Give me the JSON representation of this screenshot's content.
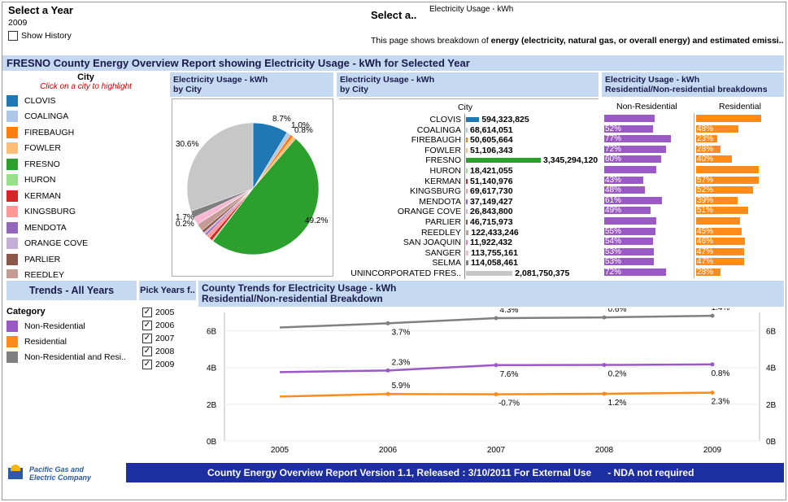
{
  "header": {
    "select_year_label": "Select a Year",
    "year_value": "2009",
    "show_history_label": "Show History",
    "select_energy_label": "Select a..",
    "energy_value": "Electricity Usage - kWh",
    "description_prefix": "This page shows breakdown of ",
    "description_bold": "energy (electricity, natural gas, or overall energy) and estimated emissi.."
  },
  "title_bar": "FRESNO County Energy Overview Report showing Electricity Usage - kWh for Selected Year",
  "legend": {
    "title": "City",
    "subtitle": "Click on a city to highlight",
    "items": [
      {
        "label": "CLOVIS",
        "color": "#1f77b4"
      },
      {
        "label": "COALINGA",
        "color": "#aec7e8"
      },
      {
        "label": "FIREBAUGH",
        "color": "#ff7f0e"
      },
      {
        "label": "FOWLER",
        "color": "#ffbb78"
      },
      {
        "label": "FRESNO",
        "color": "#2ca02c"
      },
      {
        "label": "HURON",
        "color": "#98df8a"
      },
      {
        "label": "KERMAN",
        "color": "#d62728"
      },
      {
        "label": "KINGSBURG",
        "color": "#ff9896"
      },
      {
        "label": "MENDOTA",
        "color": "#9467bd"
      },
      {
        "label": "ORANGE COVE",
        "color": "#c5b0d5"
      },
      {
        "label": "PARLIER",
        "color": "#8c564b"
      },
      {
        "label": "REEDLEY",
        "color": "#c49c94"
      }
    ]
  },
  "pie_panel": {
    "title_line1": "Electricity Usage - kWh",
    "title_line2": "by City",
    "labels": [
      "8.7%",
      "1.0%",
      "0.8%",
      "30.6%",
      "49.2%",
      "1.7%",
      "0.2%"
    ]
  },
  "bar_panel": {
    "title_line1": "Electricity Usage - kWh",
    "title_line2": "by City",
    "column_header": "City"
  },
  "split_panel": {
    "title_line1": "Electricity Usage - kWh",
    "title_line2": "Residential/Non-residential breakdowns",
    "col_nonres": "Non-Residential",
    "col_res": "Residential",
    "nonres_color": "#9b59c6",
    "res_color": "#ff8c1a"
  },
  "trends": {
    "heading": "Trends - All Years",
    "category_label": "Category",
    "categories": [
      {
        "label": "Non-Residential",
        "color": "#9b59c6"
      },
      {
        "label": "Residential",
        "color": "#ff8c1a"
      },
      {
        "label": "Non-Residential and Resi..",
        "color": "#808080"
      }
    ],
    "pick_years_label": "Pick Years f..",
    "years": [
      "2005",
      "2006",
      "2007",
      "2008",
      "2009"
    ],
    "chart_title_line1": "County Trends for Electricity Usage - kWh",
    "chart_title_line2": "Residential/Non-residential Breakdown",
    "y_ticks": [
      "6B",
      "4B",
      "2B",
      "0B"
    ]
  },
  "footer": {
    "logo_line1": "Pacific Gas and",
    "logo_line2": "Electric Company",
    "banner": "County Energy Overview Report Version 1.1, Released : 3/10/2011  For External Use",
    "nda": "- NDA not required"
  },
  "chart_data": [
    {
      "type": "pie",
      "title": "Electricity Usage - kWh by City",
      "slices": [
        {
          "label": "CLOVIS",
          "value": 8.7
        },
        {
          "label": "COALINGA",
          "value": 1.0
        },
        {
          "label": "FIREBAUGH",
          "value": 0.8
        },
        {
          "label": "FOWLER",
          "value": 0.8
        },
        {
          "label": "FRESNO",
          "value": 49.2
        },
        {
          "label": "HURON",
          "value": 0.3
        },
        {
          "label": "KERMAN",
          "value": 0.8
        },
        {
          "label": "KINGSBURG",
          "value": 1.0
        },
        {
          "label": "MENDOTA",
          "value": 0.5
        },
        {
          "label": "ORANGE COVE",
          "value": 0.4
        },
        {
          "label": "PARLIER",
          "value": 0.7
        },
        {
          "label": "REEDLEY",
          "value": 1.8
        },
        {
          "label": "SAN JOAQUIN",
          "value": 0.2
        },
        {
          "label": "SANGER",
          "value": 1.7
        },
        {
          "label": "SELMA",
          "value": 1.7
        },
        {
          "label": "UNINCORPORATED FRES..",
          "value": 30.6
        }
      ]
    },
    {
      "type": "bar",
      "title": "Electricity Usage - kWh by City",
      "categories": [
        "CLOVIS",
        "COALINGA",
        "FIREBAUGH",
        "FOWLER",
        "FRESNO",
        "HURON",
        "KERMAN",
        "KINGSBURG",
        "MENDOTA",
        "ORANGE COVE",
        "PARLIER",
        "REEDLEY",
        "SAN JOAQUIN",
        "SANGER",
        "SELMA",
        "UNINCORPORATED FRES.."
      ],
      "values": [
        594323825,
        68614051,
        50605664,
        51106343,
        3345294120,
        18421055,
        51140976,
        69617730,
        37149427,
        26843800,
        46715973,
        122433246,
        11922432,
        113755161,
        114058461,
        2081750375
      ],
      "value_labels": [
        "594,323,825",
        "68,614,051",
        "50,605,664",
        "51,106,343",
        "3,345,294,120",
        "18,421,055",
        "51,140,976",
        "69,617,730",
        "37,149,427",
        "26,843,800",
        "46,715,973",
        "122,433,246",
        "11,922,432",
        "113,755,161",
        "114,058,461",
        "2,081,750,375"
      ],
      "colors": [
        "#1f77b4",
        "#aec7e8",
        "#ff7f0e",
        "#ffbb78",
        "#2ca02c",
        "#98df8a",
        "#d62728",
        "#ff9896",
        "#9467bd",
        "#c5b0d5",
        "#8c564b",
        "#c49c94",
        "#e377c2",
        "#f7b6d2",
        "#7f7f7f",
        "#c7c7c7"
      ]
    },
    {
      "type": "bar",
      "title": "Residential/Non-residential breakdowns",
      "categories": [
        "CLOVIS",
        "COALINGA",
        "FIREBAUGH",
        "FOWLER",
        "FRESNO",
        "HURON",
        "KERMAN",
        "KINGSBURG",
        "MENDOTA",
        "ORANGE COVE",
        "PARLIER",
        "REEDLEY",
        "SAN JOAQUIN",
        "SANGER",
        "SELMA",
        "UNINCORPORATED FRES.."
      ],
      "series": [
        {
          "name": "Non-Residential",
          "values": [
            null,
            52,
            77,
            72,
            60,
            null,
            43,
            48,
            61,
            49,
            null,
            55,
            54,
            53,
            53,
            72
          ],
          "labels": [
            "",
            "52%",
            "77%",
            "72%",
            "60%",
            "",
            "43%",
            "48%",
            "61%",
            "49%",
            "",
            "55%",
            "54%",
            "53%",
            "53%",
            "72%"
          ],
          "bar_frac": [
            0.62,
            0.6,
            0.82,
            0.76,
            0.7,
            0.64,
            0.48,
            0.5,
            0.71,
            0.57,
            0.64,
            0.63,
            0.6,
            0.61,
            0.61,
            0.76
          ]
        },
        {
          "name": "Residential",
          "values": [
            null,
            48,
            23,
            28,
            40,
            null,
            57,
            52,
            39,
            51,
            null,
            45,
            46,
            47,
            47,
            28
          ],
          "labels": [
            "",
            "48%",
            "23%",
            "28%",
            "40%",
            "",
            "57%",
            "52%",
            "39%",
            "51%",
            "",
            "45%",
            "46%",
            "47%",
            "47%",
            "28%"
          ],
          "bar_frac": [
            0.8,
            0.52,
            0.26,
            0.3,
            0.44,
            0.77,
            0.77,
            0.7,
            0.51,
            0.64,
            0.54,
            0.56,
            0.6,
            0.59,
            0.59,
            0.3
          ]
        }
      ]
    },
    {
      "type": "line",
      "title": "County Trends for Electricity Usage - kWh Residential/Non-residential Breakdown",
      "x": [
        2005,
        2006,
        2007,
        2008,
        2009
      ],
      "ylim": [
        0,
        7
      ],
      "y_unit": "B",
      "series": [
        {
          "name": "Non-Residential and Resi..",
          "color": "#808080",
          "values": [
            6.18,
            6.41,
            6.69,
            6.73,
            6.82
          ],
          "labels": [
            "",
            "3.7%",
            "4.3%",
            "0.6%",
            "1.4%"
          ]
        },
        {
          "name": "Non-Residential",
          "color": "#9b59c6",
          "values": [
            3.75,
            3.84,
            4.13,
            4.14,
            4.17
          ],
          "labels": [
            "",
            "2.3%",
            "7.6%",
            "0.2%",
            "0.8%"
          ]
        },
        {
          "name": "Residential",
          "color": "#ff8c1a",
          "values": [
            2.42,
            2.56,
            2.54,
            2.57,
            2.63
          ],
          "labels": [
            "",
            "5.9%",
            "-0.7%",
            "1.2%",
            "2.3%"
          ]
        }
      ]
    }
  ]
}
